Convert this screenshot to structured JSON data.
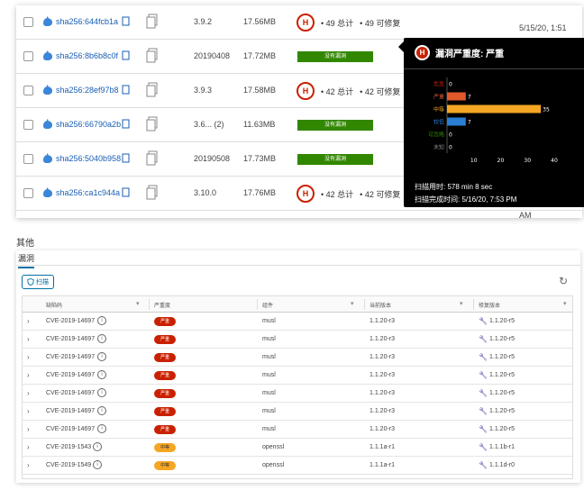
{
  "top_rows": [
    {
      "digest": "sha256:644fcb1a",
      "tag": "3.9.2",
      "size": "17.56MB",
      "vuln_type": "high",
      "badge": "H",
      "total": "• 49 总计",
      "fixable": "• 49 可修复"
    },
    {
      "digest": "sha256:8b6b8c0f",
      "tag": "20190408",
      "size": "17.72MB",
      "vuln_type": "none",
      "no_vuln": "没有漏洞"
    },
    {
      "digest": "sha256:28ef97b8",
      "tag": "3.9.3",
      "size": "17.58MB",
      "vuln_type": "high",
      "badge": "H",
      "total": "• 42 总计",
      "fixable": "• 42 可修复"
    },
    {
      "digest": "sha256:66790a2b",
      "tag": "3.6... (2)",
      "size": "11.63MB",
      "vuln_type": "none",
      "no_vuln": "没有漏洞"
    },
    {
      "digest": "sha256:5040b958",
      "tag": "20190508",
      "size": "17.73MB",
      "vuln_type": "none",
      "no_vuln": "没有漏洞"
    },
    {
      "digest": "sha256:ca1c944a",
      "tag": "3.10.0",
      "size": "17.76MB",
      "vuln_type": "high",
      "badge": "H",
      "total": "• 42 总计",
      "fixable": "• 42 可修复"
    }
  ],
  "push_time": {
    "date": "5/15/20, 1:51",
    "ampm": "AM"
  },
  "tooltip": {
    "badge": "H",
    "title": "漏洞严重度: 严重",
    "scan_duration": "扫描用时: 578 min 8 sec",
    "scan_completed": "扫描完成时间: 5/16/20, 7:53 PM"
  },
  "chart_data": {
    "type": "bar",
    "orientation": "horizontal",
    "categories": [
      "危急",
      "严重",
      "中等",
      "较低",
      "可忽略",
      "未知"
    ],
    "values": [
      0,
      7,
      35,
      7,
      0,
      0
    ],
    "value_labels": [
      "0",
      "7",
      "35",
      "7",
      "0",
      "0"
    ],
    "colors": [
      "#c92100",
      "#e05a2b",
      "#f5a623",
      "#2a7fd4",
      "#318700",
      "#8c8c8c"
    ],
    "ticks": [
      "10",
      "20",
      "30",
      "40"
    ],
    "xlim": [
      0,
      40
    ],
    "xlabel": "",
    "ylabel": "",
    "title": ""
  },
  "section": {
    "title": "其他",
    "tab": "漏洞",
    "scan_button": "扫描"
  },
  "grid": {
    "headers": [
      "缺陷码",
      "严重度",
      "组件",
      "当前版本",
      "修复版本"
    ],
    "rows": [
      {
        "cve": "CVE-2019-14697",
        "severity": "high",
        "severity_label": "严重",
        "package": "musl",
        "current": "1.1.20-r3",
        "fixed": "1.1.20-r5"
      },
      {
        "cve": "CVE-2019-14697",
        "severity": "high",
        "severity_label": "严重",
        "package": "musl",
        "current": "1.1.20-r3",
        "fixed": "1.1.20-r5"
      },
      {
        "cve": "CVE-2019-14697",
        "severity": "high",
        "severity_label": "严重",
        "package": "musl",
        "current": "1.1.20-r3",
        "fixed": "1.1.20-r5"
      },
      {
        "cve": "CVE-2019-14697",
        "severity": "high",
        "severity_label": "严重",
        "package": "musl",
        "current": "1.1.20-r3",
        "fixed": "1.1.20-r5"
      },
      {
        "cve": "CVE-2019-14697",
        "severity": "high",
        "severity_label": "严重",
        "package": "musl",
        "current": "1.1.20-r3",
        "fixed": "1.1.20-r5"
      },
      {
        "cve": "CVE-2019-14697",
        "severity": "high",
        "severity_label": "严重",
        "package": "musl",
        "current": "1.1.20-r3",
        "fixed": "1.1.20-r5"
      },
      {
        "cve": "CVE-2019-14697",
        "severity": "high",
        "severity_label": "严重",
        "package": "musl",
        "current": "1.1.20-r3",
        "fixed": "1.1.20-r5"
      },
      {
        "cve": "CVE-2019-1543",
        "severity": "medium",
        "severity_label": "中等",
        "package": "openssl",
        "current": "1.1.1a-r1",
        "fixed": "1.1.1b-r1"
      },
      {
        "cve": "CVE-2019-1549",
        "severity": "medium",
        "severity_label": "中等",
        "package": "openssl",
        "current": "1.1.1a-r1",
        "fixed": "1.1.1d-r0"
      }
    ]
  }
}
